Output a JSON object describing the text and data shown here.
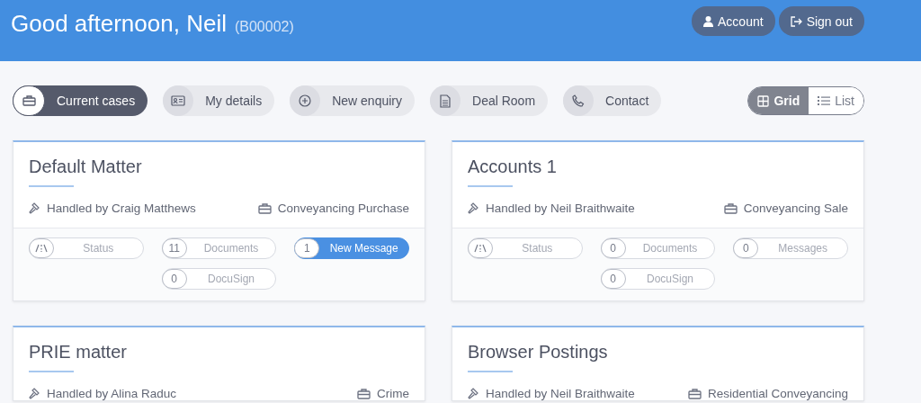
{
  "header": {
    "greeting": "Good afternoon, Neil",
    "code": "(B00002)",
    "buttons": [
      {
        "kind": "account",
        "label": "Account"
      },
      {
        "kind": "signout",
        "label": "Sign out"
      }
    ]
  },
  "nav": [
    {
      "kind": "cases",
      "label": "Current cases",
      "selected": true
    },
    {
      "kind": "details",
      "label": "My details",
      "selected": false
    },
    {
      "kind": "enquiry",
      "label": "New enquiry",
      "selected": false
    },
    {
      "kind": "dealroom",
      "label": "Deal Room",
      "selected": false
    },
    {
      "kind": "contact",
      "label": "Contact",
      "selected": false
    }
  ],
  "view_toggle": [
    {
      "kind": "grid",
      "label": "Grid",
      "selected": true
    },
    {
      "kind": "list",
      "label": "List",
      "selected": false
    }
  ],
  "cases": [
    {
      "title": "Default Matter",
      "handler": "Handled by Craig Matthews",
      "type": "Conveyancing Purchase",
      "links": [
        {
          "kind": "status",
          "label": "Status",
          "highlighted": false
        },
        {
          "kind": "count",
          "count": "11",
          "label": "Documents",
          "highlighted": false
        },
        {
          "kind": "count",
          "count": "1",
          "label": "New Message",
          "highlighted": true
        },
        {
          "kind": "count",
          "count": "0",
          "label": "DocuSign",
          "highlighted": false
        }
      ]
    },
    {
      "title": "Accounts 1",
      "handler": "Handled by Neil Braithwaite",
      "type": "Conveyancing Sale",
      "links": [
        {
          "kind": "status",
          "label": "Status",
          "highlighted": false
        },
        {
          "kind": "count",
          "count": "0",
          "label": "Documents",
          "highlighted": false
        },
        {
          "kind": "count",
          "count": "0",
          "label": "Messages",
          "highlighted": false
        },
        {
          "kind": "count",
          "count": "0",
          "label": "DocuSign",
          "highlighted": false
        }
      ]
    },
    {
      "title": "PRIE matter",
      "handler": "Handled by Alina Raduc",
      "type": "Crime"
    },
    {
      "title": "Browser Postings",
      "handler": "Handled by Neil Braithwaite",
      "type": "Residential Conveyancing"
    }
  ]
}
